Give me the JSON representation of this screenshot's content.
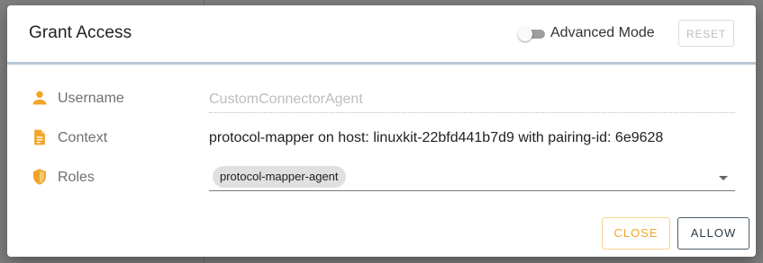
{
  "dialog": {
    "title": "Grant Access",
    "advanced_mode_label": "Advanced Mode",
    "advanced_mode_enabled": false,
    "reset_label": "RESET"
  },
  "fields": {
    "username": {
      "label": "Username",
      "icon": "person-icon",
      "placeholder": "CustomConnectorAgent",
      "value": ""
    },
    "context": {
      "label": "Context",
      "icon": "document-icon",
      "value": "protocol-mapper on host: linuxkit-22bfd441b7d9 with pairing-id: 6e9628"
    },
    "roles": {
      "label": "Roles",
      "icon": "shield-icon",
      "selected": [
        "protocol-mapper-agent"
      ]
    }
  },
  "actions": {
    "close_label": "CLOSE",
    "allow_label": "ALLOW"
  },
  "colors": {
    "accent": "#f0a52a",
    "header_rule": "#b7c6d3",
    "allow_border": "#4b5b66"
  }
}
